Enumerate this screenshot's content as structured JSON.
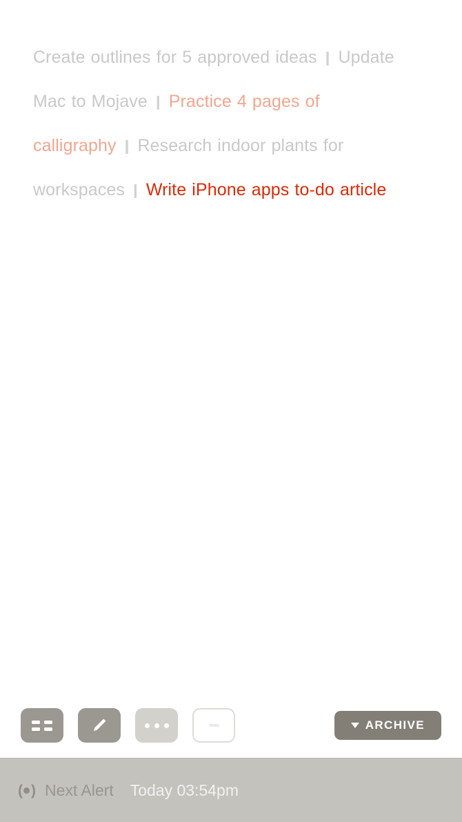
{
  "tasks": {
    "separator": "❙",
    "colors": {
      "done": "#c9c9c9",
      "pending": "#f2a68f",
      "active": "#dd2a06"
    },
    "items": [
      {
        "text": "Create outlines for 5 approved ideas",
        "state": "done"
      },
      {
        "text": "Update Mac to Mojave",
        "state": "done"
      },
      {
        "text": "Practice 4 pages of calligraphy",
        "state": "pending"
      },
      {
        "text": "Research indoor plants for workspaces",
        "state": "done"
      },
      {
        "text": "Write iPhone apps to-do article",
        "state": "active"
      }
    ]
  },
  "toolbar": {
    "buttons": [
      {
        "name": "grid-view-button",
        "icon": "grid-icon",
        "style": "dark"
      },
      {
        "name": "edit-button",
        "icon": "pencil-icon",
        "style": "dark"
      },
      {
        "name": "more-options-button",
        "icon": "ellipsis-icon",
        "style": "light"
      },
      {
        "name": "collapse-button",
        "icon": "dash-icon",
        "style": "hollow"
      }
    ],
    "archive": {
      "label": "ARCHIVE",
      "caret": "▼",
      "color": "#847f76"
    }
  },
  "status_bar": {
    "icon": "alert-broadcast-icon",
    "label": "Next Alert",
    "time": "Today 03:54pm",
    "background": "#c4c2bd"
  }
}
